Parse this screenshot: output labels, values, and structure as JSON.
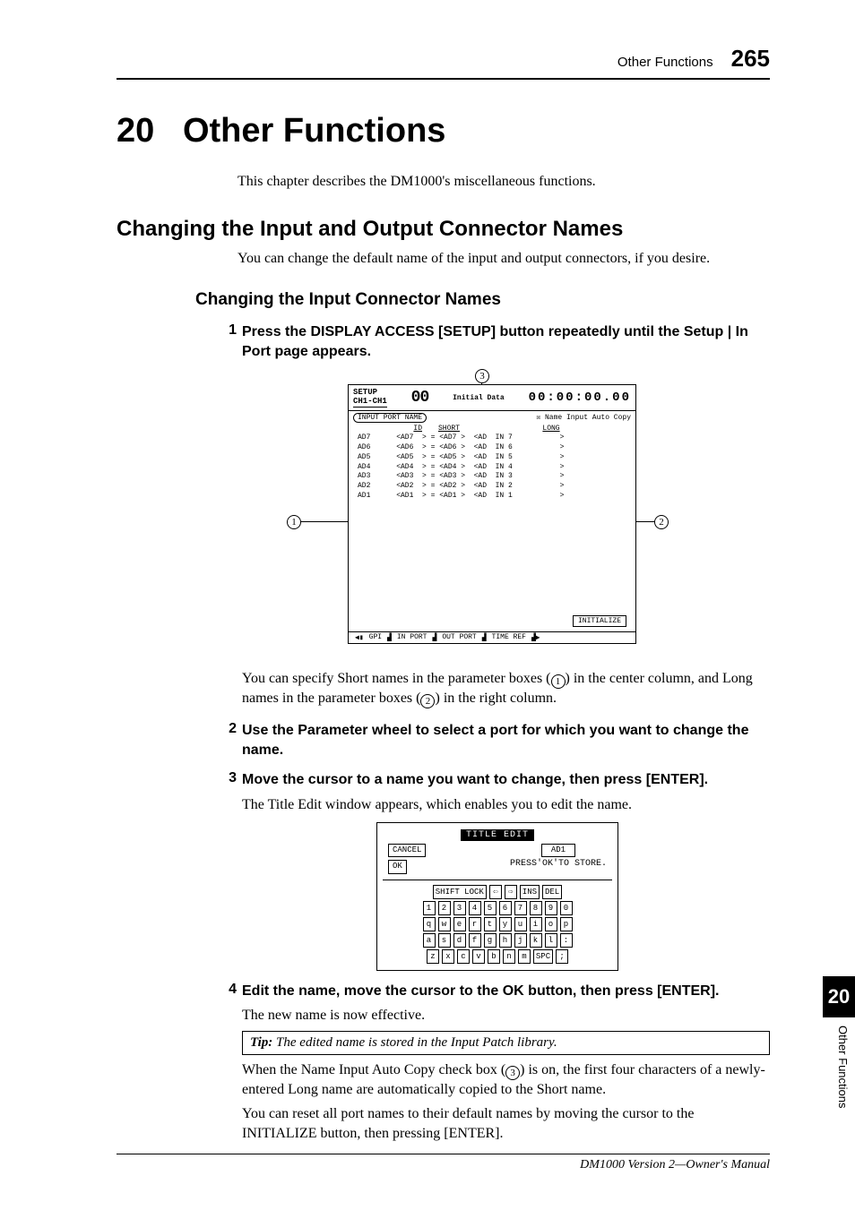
{
  "header": {
    "section": "Other Functions",
    "page": "265"
  },
  "chapter": {
    "num": "20",
    "title": "Other Functions"
  },
  "intro": "This chapter describes the DM1000's miscellaneous functions.",
  "section1": {
    "title": "Changing the Input and Output Connector Names",
    "intro": "You can change the default name of the input and output connectors, if you desire."
  },
  "subsection1": {
    "title": "Changing the Input Connector Names"
  },
  "steps": {
    "s1": {
      "n": "1",
      "bold": "Press the DISPLAY ACCESS [SETUP] button repeatedly until the Setup | In Port page appears."
    },
    "s2": {
      "n": "2",
      "bold": "Use the Parameter wheel to select a port for which you want to change the name."
    },
    "s3": {
      "n": "3",
      "bold": "Move the cursor to a name you want to change, then press [ENTER].",
      "body": "The Title Edit window appears, which enables you to edit the name."
    },
    "s4": {
      "n": "4",
      "bold": "Edit the name, move the cursor to the OK button, then press [ENTER].",
      "body": "The new name is now effective."
    }
  },
  "para_after_fig_a": "You can specify Short names in the parameter boxes (",
  "para_after_fig_b": ") in the center column, and Long names in the parameter boxes (",
  "para_after_fig_c": ") in the right column.",
  "tip": {
    "label": "Tip:",
    "text": "  The edited name is stored in the Input Patch library."
  },
  "after_tip_a": "When the Name Input Auto Copy check box (",
  "after_tip_b": ") is on, the first four characters of a newly-entered Long name are automatically copied to the Short name.",
  "after_tip_2": "You can reset all port names to their default names by moving the cursor to the INITIALIZE button, then pressing [ENTER].",
  "lcd1": {
    "setup": "SETUP",
    "ch": "CH1-CH1",
    "dig": "00",
    "sceneLabel": "Initial Data",
    "tc": "00:00:00.00",
    "tab": "INPUT PORT NAME",
    "autocopy": "Name Input Auto Copy",
    "hdr_id": "ID",
    "hdr_short": "SHORT",
    "hdr_long": "LONG",
    "rows": [
      "AD7      <AD7  > = <AD7 >  <AD  IN 7           >",
      "AD6      <AD6  > = <AD6 >  <AD  IN 6           >",
      "AD5      <AD5  > = <AD5 >  <AD  IN 5           >",
      "AD4      <AD4  > = <AD4 >  <AD  IN 4           >",
      "AD3      <AD3  > = <AD3 >  <AD  IN 3           >",
      "AD2      <AD2  > = <AD2 >  <AD  IN 2           >",
      "AD1      <AD1  > = <AD1 >  <AD  IN 1           >"
    ],
    "init": "INITIALIZE",
    "bottom": [
      "GPI",
      "IN PORT",
      "OUT PORT",
      "TIME REF"
    ]
  },
  "lcd2": {
    "title": "TITLE EDIT",
    "cancel": "CANCEL",
    "ok": "OK",
    "val": "AD1",
    "hint": "PRESS'OK'TO STORE.",
    "shift": "SHIFT LOCK",
    "ins": "INS",
    "del": "DEL",
    "row_num": [
      "1",
      "2",
      "3",
      "4",
      "5",
      "6",
      "7",
      "8",
      "9",
      "0"
    ],
    "row_q": [
      "q",
      "w",
      "e",
      "r",
      "t",
      "y",
      "u",
      "i",
      "o",
      "p"
    ],
    "row_a": [
      "a",
      "s",
      "d",
      "f",
      "g",
      "h",
      "j",
      "k",
      "l",
      ":"
    ],
    "row_z": [
      "z",
      "x",
      "c",
      "v",
      "b",
      "n",
      "m",
      "SPC",
      ";"
    ]
  },
  "callouts": {
    "c1": "1",
    "c2": "2",
    "c3": "3"
  },
  "thumb": {
    "num": "20",
    "label": "Other Functions"
  },
  "footer": "DM1000 Version 2—Owner's Manual"
}
